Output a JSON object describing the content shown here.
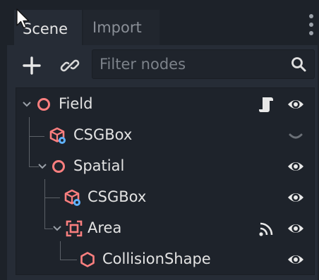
{
  "tabs": [
    {
      "label": "Scene",
      "active": true
    },
    {
      "label": "Import",
      "active": false
    }
  ],
  "toolbar": {
    "add_icon": "plus-icon",
    "link_icon": "link-icon",
    "filter_placeholder": "Filter nodes",
    "search_icon": "search-icon"
  },
  "tree": {
    "nodes": [
      {
        "label": "Field",
        "icon": "spatial-node-icon",
        "expanded": true,
        "extra_icon": "script-icon",
        "visibility": "visible"
      },
      {
        "label": "CSGBox",
        "icon": "csg-box-icon",
        "visibility": "hidden"
      },
      {
        "label": "Spatial",
        "icon": "spatial-node-icon",
        "expanded": true,
        "visibility": "visible"
      },
      {
        "label": "CSGBox",
        "icon": "csg-box-icon",
        "visibility": "visible"
      },
      {
        "label": "Area",
        "icon": "area-icon",
        "expanded": true,
        "extra_icon": "signal-icon",
        "visibility": "visible"
      },
      {
        "label": "CollisionShape",
        "icon": "collision-shape-icon",
        "visibility": "visible"
      }
    ]
  },
  "colors": {
    "panel_bg": "#262c36",
    "tree_bg": "#1e232b",
    "node_icon": "#fc7f7f",
    "csg_accent": "#5fb2ff",
    "text": "#e0e0e0",
    "muted_text": "#8a8f97"
  }
}
